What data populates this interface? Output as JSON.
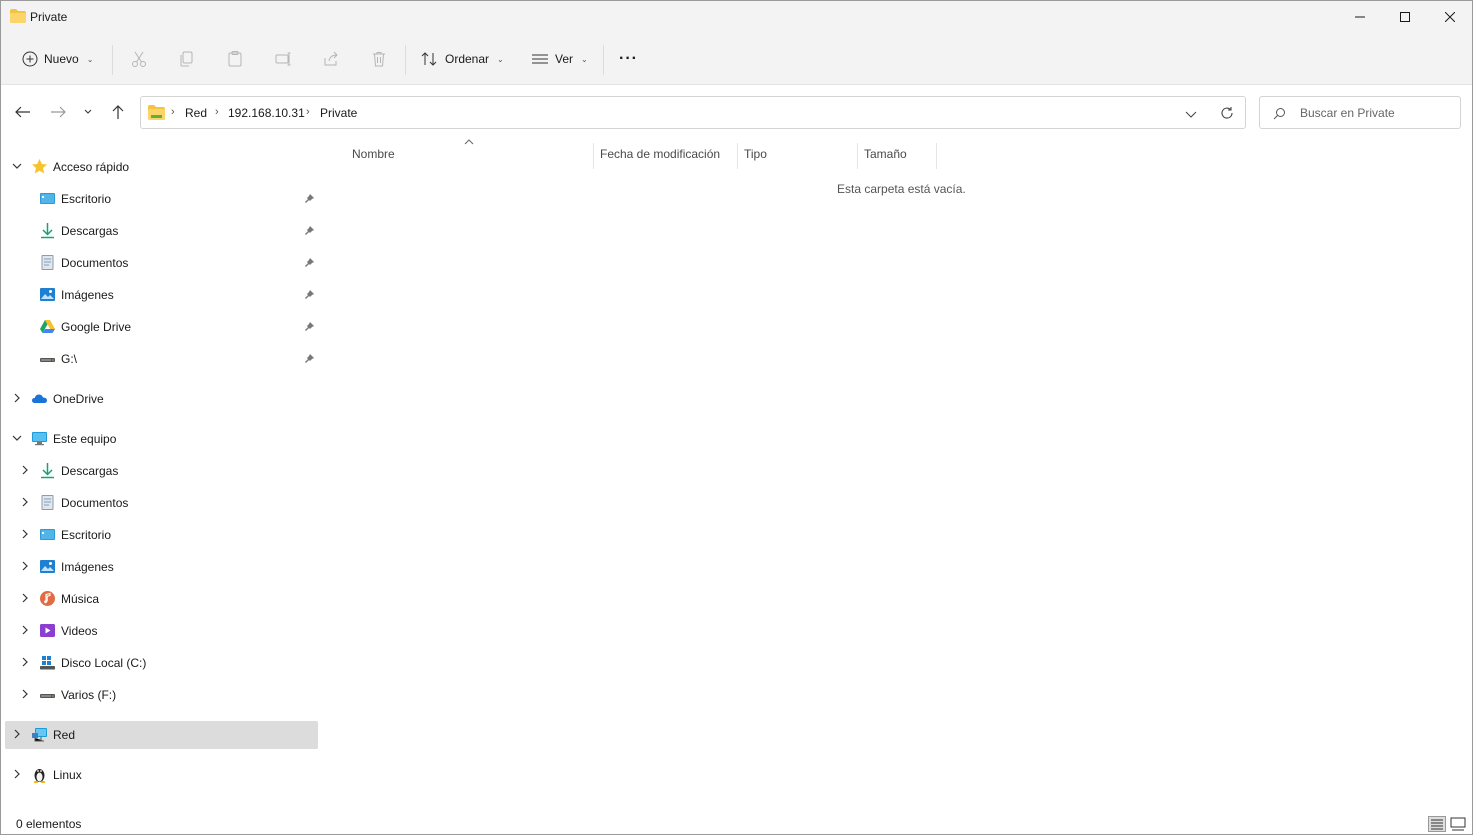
{
  "window": {
    "title": "Private"
  },
  "toolbar": {
    "new_label": "Nuevo",
    "sort_label": "Ordenar",
    "view_label": "Ver",
    "more_label": "···"
  },
  "address": {
    "crumbs": [
      "Red",
      "192.168.10.31",
      "Private"
    ]
  },
  "search": {
    "placeholder": "Buscar en Private"
  },
  "sidebar": {
    "quick_access": {
      "label": "Acceso rápido",
      "items": [
        {
          "label": "Escritorio",
          "icon": "desktop-icon"
        },
        {
          "label": "Descargas",
          "icon": "download-icon"
        },
        {
          "label": "Documentos",
          "icon": "documents-icon"
        },
        {
          "label": "Imágenes",
          "icon": "pictures-icon"
        },
        {
          "label": "Google Drive",
          "icon": "google-drive-icon"
        },
        {
          "label": "G:\\",
          "icon": "drive-icon"
        }
      ]
    },
    "onedrive": {
      "label": "OneDrive"
    },
    "this_pc": {
      "label": "Este equipo",
      "items": [
        {
          "label": "Descargas",
          "icon": "download-icon"
        },
        {
          "label": "Documentos",
          "icon": "documents-icon"
        },
        {
          "label": "Escritorio",
          "icon": "desktop-icon"
        },
        {
          "label": "Imágenes",
          "icon": "pictures-icon"
        },
        {
          "label": "Música",
          "icon": "music-icon"
        },
        {
          "label": "Videos",
          "icon": "videos-icon"
        },
        {
          "label": "Disco Local (C:)",
          "icon": "windows-drive-icon"
        },
        {
          "label": "Varios (F:)",
          "icon": "drive-icon"
        }
      ]
    },
    "network": {
      "label": "Red"
    },
    "linux": {
      "label": "Linux"
    }
  },
  "content": {
    "columns": [
      "Nombre",
      "Fecha de modificación",
      "Tipo",
      "Tamaño"
    ],
    "empty_message": "Esta carpeta está vacía."
  },
  "status": {
    "count": "0 elementos"
  },
  "colors": {
    "chrome_bg": "#f3f3f3",
    "selected_bg": "#dcdcdc",
    "folder_yellow": "#f5c342",
    "accent_blue": "#0078d4"
  }
}
